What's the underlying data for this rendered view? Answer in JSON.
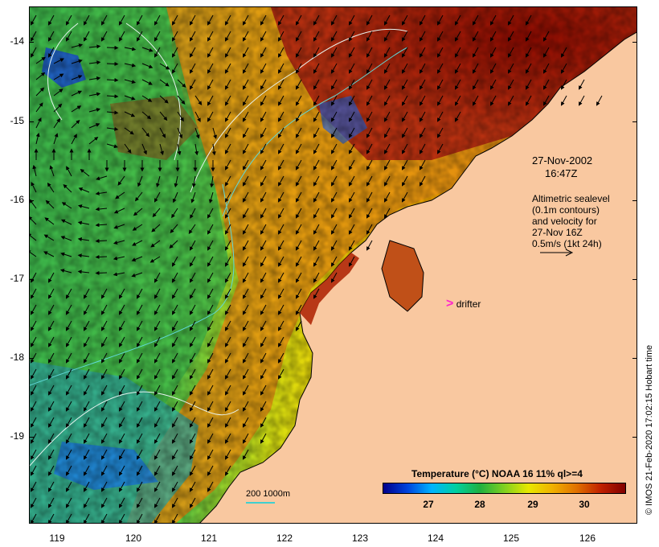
{
  "map": {
    "lat_labels": [
      "-14",
      "-15",
      "-16",
      "-17",
      "-18",
      "-19"
    ],
    "lon_labels": [
      "119",
      "120",
      "121",
      "122",
      "123",
      "124",
      "125",
      "126"
    ],
    "date_line1": "27-Nov-2002",
    "date_line2": "16:47Z",
    "alti_lines": [
      "Altimetric sealevel",
      "(0.1m contours)",
      "and velocity for",
      "27-Nov 16Z",
      "0.5m/s (1kt 24h)"
    ],
    "drifter_mark": ">",
    "drifter_label": "drifter",
    "contour_key": "200  1000m",
    "colorbar_title": "Temperature (°C) NOAA 16 11% ql>=4",
    "colorbar_ticks": [
      "27",
      "28",
      "29",
      "30"
    ],
    "credit": "© IMOS 21-Feb-2020 17:02:15 Hobart time",
    "colors": {
      "land": "#f9c8a0",
      "cold": "#0044dd",
      "cool": "#20b040",
      "mid": "#e8e800",
      "warm": "#e07000",
      "hot": "#a01000",
      "contour": "#40d0d0",
      "drifter": "#ff22cc"
    }
  }
}
